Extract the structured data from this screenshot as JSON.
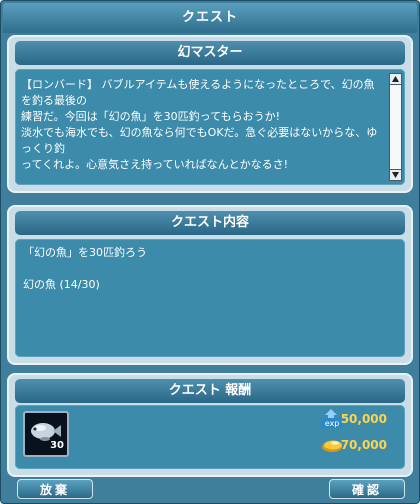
{
  "window": {
    "title": "クエスト"
  },
  "npc_panel": {
    "heading": "幻マスター",
    "text": "【ロンバード】 バブルアイテムも使えるようになったところで、幻の魚を釣る最後の\n練習だ。今回は「幻の魚」を30匹釣ってもらおうか!\n淡水でも海水でも、幻の魚なら何でもOKだ。急ぐ必要はないからな、ゆっくり釣\nってくれよ。心意気さえ持っていればなんとかなるさ!"
  },
  "quest_panel": {
    "heading": "クエスト内容",
    "objective": "「幻の魚」を30匹釣ろう",
    "progress": "幻の魚 (14/30)"
  },
  "reward_panel": {
    "heading": "クエスト 報酬",
    "item_count": "30",
    "exp_value": "50,000",
    "gold_value": "70,000",
    "exp_icon_label": "exp",
    "icons": {
      "exp": "exp-icon",
      "gold": "gold-coin-icon",
      "item": "fish-item-icon"
    }
  },
  "buttons": {
    "abandon": "放棄",
    "confirm": "確認"
  },
  "colors": {
    "reward_value": "#ffd34a",
    "window_bg": "#3f7f9b",
    "panel_bg": "#c9dde6"
  }
}
